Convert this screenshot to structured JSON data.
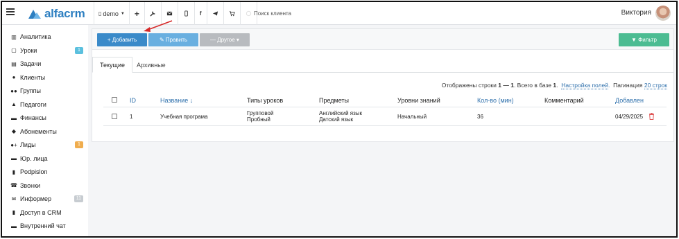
{
  "topbar": {
    "logo_text": "alfacrm",
    "branch": "demo",
    "search_placeholder": "Поиск клиента",
    "user_name": "Виктория"
  },
  "sidebar": {
    "items": [
      {
        "label": "Аналитика",
        "icon": "analytics-icon",
        "glyph": "▥"
      },
      {
        "label": "Уроки",
        "icon": "calendar-icon",
        "glyph": "▢",
        "badge": "1",
        "badge_color": "#5bc0de"
      },
      {
        "label": "Задачи",
        "icon": "tasks-icon",
        "glyph": "▤"
      },
      {
        "label": "Клиенты",
        "icon": "user-icon",
        "glyph": "●"
      },
      {
        "label": "Группы",
        "icon": "group-icon",
        "glyph": "●●"
      },
      {
        "label": "Педагоги",
        "icon": "graduation-cap-icon",
        "glyph": "▲"
      },
      {
        "label": "Финансы",
        "icon": "money-icon",
        "glyph": "▬"
      },
      {
        "label": "Абонементы",
        "icon": "tag-icon",
        "glyph": "◆"
      },
      {
        "label": "Лиды",
        "icon": "add-user-icon",
        "glyph": "●+",
        "badge": "1",
        "badge_color": "#f0ad4e"
      },
      {
        "label": "Юр. лица",
        "icon": "briefcase-icon",
        "glyph": "▬"
      },
      {
        "label": "Podpislon",
        "icon": "file-icon",
        "glyph": "▮"
      },
      {
        "label": "Звонки",
        "icon": "phone-icon",
        "glyph": "☎"
      },
      {
        "label": "Информер",
        "icon": "envelope-icon",
        "glyph": "✉",
        "badge": "11",
        "badge_color": "#c7ccd1"
      },
      {
        "label": "Доступ в CRM",
        "icon": "lock-icon",
        "glyph": "▮"
      },
      {
        "label": "Внутренний чат",
        "icon": "chat-icon",
        "glyph": "▬"
      }
    ]
  },
  "toolbar": {
    "add_label": "+ Добавить",
    "edit_label": "✎ Править",
    "other_label": "— Другое ▾",
    "filter_label": "▼ Фильтр"
  },
  "tabs": {
    "current": "Текущие",
    "archive": "Архивные"
  },
  "info": {
    "prefix": "Отображены строки ",
    "range": "1 — 1",
    "middle": ". Всего в базе ",
    "total": "1",
    "after_total": ".",
    "settings_link": "Настройка полей",
    "pagination_label": "Пагинация",
    "pagination_link": "20 строк"
  },
  "table": {
    "headers": {
      "id": "ID",
      "name": "Название ↓",
      "lesson_types": "Типы уроков",
      "subjects": "Предметы",
      "levels": "Уровни знаний",
      "duration": "Кол-во (мин)",
      "comment": "Комментарий",
      "added": "Добавлен"
    },
    "rows": [
      {
        "id": "1",
        "name": "Учебная програма",
        "lesson_type_1": "Групповой",
        "lesson_type_2": "Пробный",
        "subject_1": "Английский язык",
        "subject_2": "Датский язык",
        "level": "Начальный",
        "duration": "36",
        "comment": "",
        "added": "04/29/2025"
      }
    ]
  },
  "colors": {
    "accent": "#2d7fc1",
    "add_button": "#3a8ac9",
    "filter_button": "#4cbc92",
    "delete": "#e05a5a"
  }
}
